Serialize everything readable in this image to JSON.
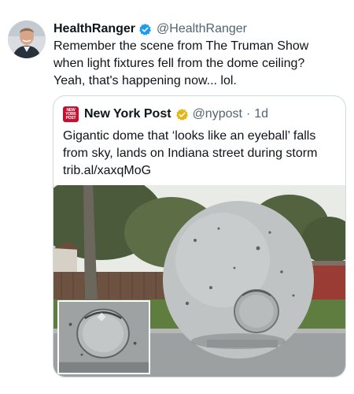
{
  "tweet": {
    "author_name": "HealthRanger",
    "author_handle": "@HealthRanger",
    "text_lines": [
      "Remember the scene from The Truman Show",
      "when light fixtures fell from the dome ceiling?",
      "Yeah, that's happening now... lol."
    ],
    "verified_color": "#1d9bf0"
  },
  "quote": {
    "logo_text": [
      "NEW",
      "YORK",
      "POST"
    ],
    "author_name": "New York Post",
    "author_handle": "@nypost",
    "separator": "·",
    "time": "1d",
    "text_lines": [
      "Gigantic dome that ‘looks like an eyeball’ falls",
      "from sky, lands on Indiana street during storm",
      "trib.al/xaxqMoG"
    ],
    "brand_color": "#c8102e",
    "verified_color": "#e2b719"
  },
  "icons": {
    "verified": "verified-badge-icon",
    "gold_verified": "gold-verified-badge-icon"
  }
}
